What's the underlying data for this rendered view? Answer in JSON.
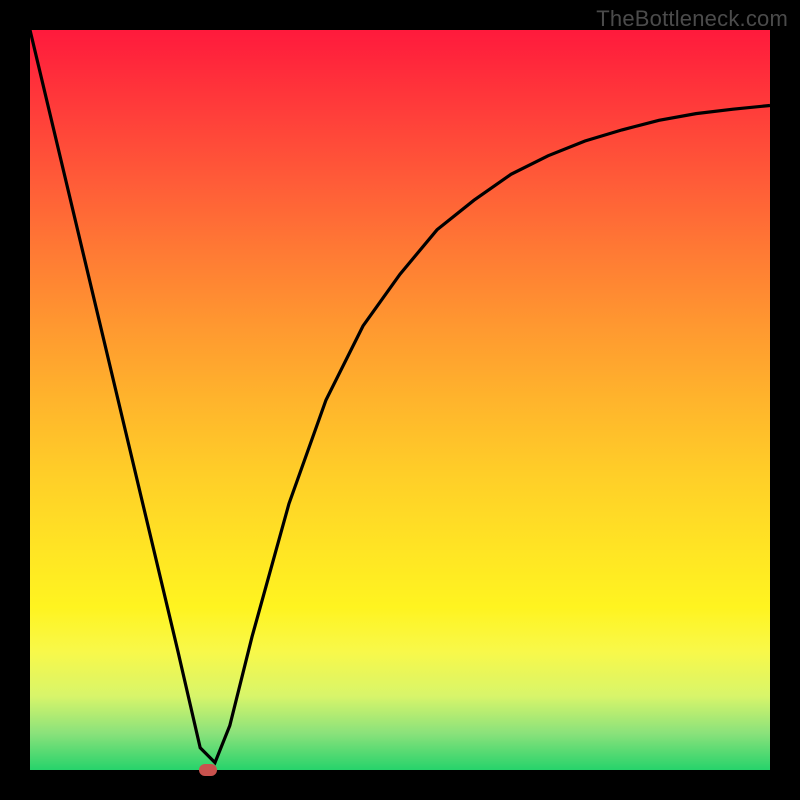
{
  "watermark": "TheBottleneck.com",
  "colors": {
    "bg": "#000000",
    "curve": "#000000",
    "marker": "#c9524e"
  },
  "chart_data": {
    "type": "line",
    "title": "",
    "xlabel": "",
    "ylabel": "",
    "xlim": [
      0,
      100
    ],
    "ylim": [
      0,
      100
    ],
    "grid": false,
    "axes_visible": false,
    "series": [
      {
        "name": "bottleneck-curve",
        "x": [
          0,
          5,
          10,
          15,
          20,
          23,
          25,
          27,
          30,
          35,
          40,
          45,
          50,
          55,
          60,
          65,
          70,
          75,
          80,
          85,
          90,
          95,
          100
        ],
        "y": [
          100,
          79,
          58,
          37,
          16,
          3,
          1,
          6,
          18,
          36,
          50,
          60,
          67,
          73,
          77,
          80.5,
          83,
          85,
          86.5,
          87.8,
          88.7,
          89.3,
          89.8
        ]
      }
    ],
    "optimal_point": {
      "x": 24,
      "y": 0
    },
    "annotations": []
  }
}
